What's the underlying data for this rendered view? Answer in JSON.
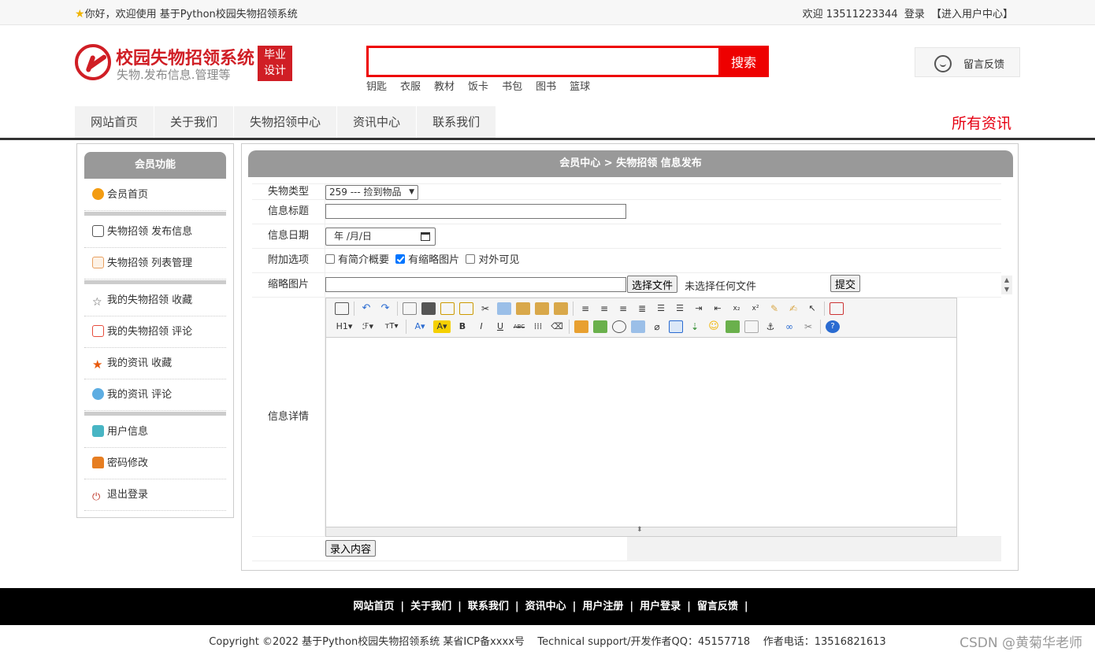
{
  "topbar": {
    "welcome": "你好，欢迎使用 基于Python校园失物招领系统",
    "user_greeting": "欢迎 13511223344",
    "login_link": "登录",
    "user_center_link": "【进入用户中心】"
  },
  "header": {
    "logo_title": "校园失物招领系统",
    "logo_subtitle": "失物.发布信息.管理等",
    "logo_badge_1": "毕业",
    "logo_badge_2": "设计",
    "search_button": "搜索",
    "hotwords": [
      "钥匙",
      "衣服",
      "教材",
      "饭卡",
      "书包",
      "图书",
      "篮球"
    ],
    "feedback": "留言反馈"
  },
  "nav": {
    "items": [
      "网站首页",
      "关于我们",
      "失物招领中心",
      "资讯中心",
      "联系我们"
    ],
    "all_news": "所有资讯"
  },
  "sidebar": {
    "title": "会员功能",
    "items": [
      "会员首页",
      "失物招领 发布信息",
      "失物招领 列表管理",
      "我的失物招领 收藏",
      "我的失物招领 评论",
      "我的资讯 收藏",
      "我的资讯 评论",
      "用户信息",
      "密码修改",
      "退出登录"
    ]
  },
  "main": {
    "breadcrumb": "会员中心 > 失物招领 信息发布",
    "labels": {
      "type": "失物类型",
      "title": "信息标题",
      "date": "信息日期",
      "options": "附加选项",
      "image": "缩略图片",
      "detail": "信息详情"
    },
    "type_selected": "259 --- 捡到物品",
    "date_placeholder": "年 /月/日",
    "options": [
      "有简介概要",
      "有缩略图片",
      "对外可见"
    ],
    "choose_file": "选择文件",
    "no_file": "未选择任何文件",
    "submit": "提交",
    "save_button": "录入内容"
  },
  "footer": {
    "links": [
      "网站首页",
      "关于我们",
      "联系我们",
      "资讯中心",
      "用户注册",
      "用户登录",
      "留言反馈"
    ],
    "copyright": "Copyright ©2022 基于Python校园失物招领系统 某省ICP备xxxx号    Technical support/开发作者QQ：45157718    作者电话：13516821613",
    "watermark": "CSDN @黄菊华老师"
  }
}
